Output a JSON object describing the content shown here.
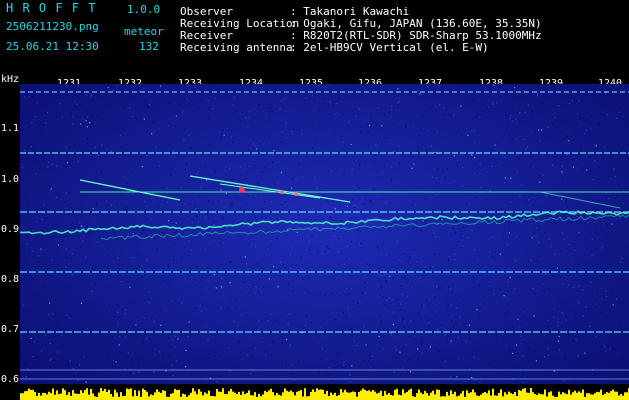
{
  "app": {
    "name": "H R O F F T",
    "version": "1.0.0",
    "filename": "2506211230.png",
    "mode": "meteor",
    "datetime": "25.06.21 12:30",
    "count": "132"
  },
  "info": [
    {
      "label": "Observer",
      "value": ": Takanori Kawachi"
    },
    {
      "label": "Receiving Location",
      "value": ": Ogaki, Gifu, JAPAN (136.60E, 35.35N)"
    },
    {
      "label": "Receiver",
      "value": ": R820T2(RTL-SDR) SDR-Sharp 53.1000MHz"
    },
    {
      "label": "Receiving antenna",
      "value": ": 2el-HB9CV Vertical (el. E-W)"
    }
  ],
  "yaxis": {
    "unit": "kHz",
    "labels": [
      "1.1",
      "1.0",
      "0.9",
      "0.8",
      "0.7",
      "0.6"
    ]
  },
  "xaxis": {
    "labels": [
      "1231",
      "1232",
      "1233",
      "1234",
      "1235",
      "1236",
      "1237",
      "1238",
      "1239",
      "1240"
    ]
  },
  "colors": {
    "background": "#07094f",
    "noise": "#2233cc",
    "signal": "#55ffcc",
    "echo": "#ff3355",
    "level": "#ffee00"
  }
}
